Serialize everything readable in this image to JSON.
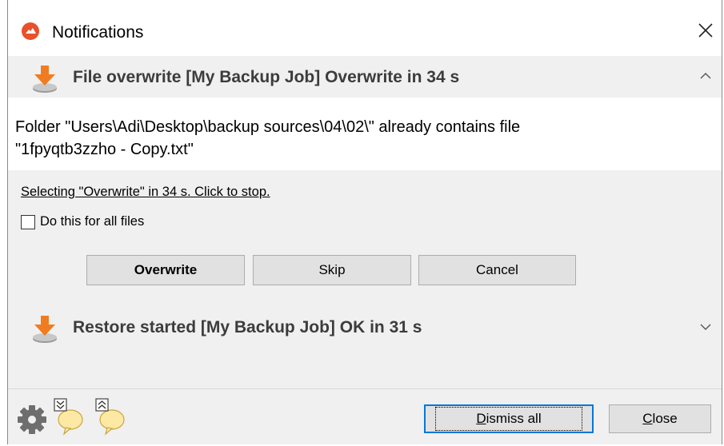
{
  "window": {
    "title": "Notifications",
    "icon": "cloud-app-icon",
    "close_icon": "close-icon"
  },
  "notification1": {
    "icon": "download-arrow-icon",
    "title": "File overwrite [My Backup Job] Overwrite in 34 s",
    "expanded": true,
    "message_line1": "Folder \"Users\\Adi\\Desktop\\backup sources\\04\\02\\\" already contains file",
    "message_line2": "\"1fpyqtb3zzho - Copy.txt\"",
    "countdown_link": "Selecting \"Overwrite\" in 34 s. Click to stop.",
    "checkbox_label": "Do this for all files",
    "checkbox_checked": false,
    "buttons": {
      "overwrite": "Overwrite",
      "skip": "Skip",
      "cancel": "Cancel"
    }
  },
  "notification2": {
    "icon": "download-arrow-icon",
    "title": "Restore started [My Backup Job] OK in 31 s",
    "expanded": false
  },
  "footer": {
    "settings_icon": "gear-icon",
    "collapse_all_icon": "collapse-all-bubble-icon",
    "expand_all_icon": "expand-all-bubble-icon",
    "dismiss_all": "Dismiss all",
    "close": "Close"
  },
  "colors": {
    "accent_orange": "#f07c22",
    "focus_blue": "#0078d7",
    "panel_gray": "#f0f0f0",
    "bubble_yellow": "#fde9a3"
  }
}
